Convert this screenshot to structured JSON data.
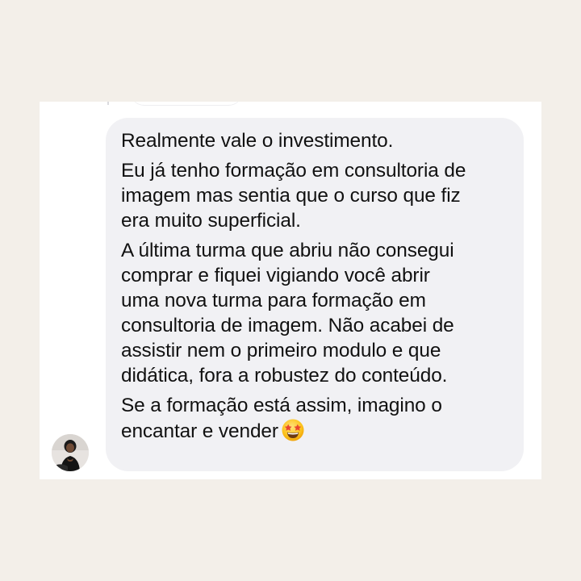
{
  "message": {
    "paragraphs": [
      {
        "lines": [
          "Realmente vale o investimento."
        ]
      },
      {
        "lines": [
          "Eu já tenho formação em consultoria de",
          "imagem mas sentia que o curso que fiz",
          "era muito superficial."
        ]
      },
      {
        "lines": [
          "A última turma que abriu não consegui",
          "comprar e fiquei vigiando você abrir",
          "uma nova turma para formação em",
          "consultoria de imagem. Não acabei de",
          "assistir nem o primeiro modulo e que",
          "didática, fora a robustez do conteúdo."
        ]
      },
      {
        "lines": [
          "Se a formação está assim, imagino o",
          "encantar e vender"
        ]
      }
    ],
    "emoji_icon": "star-struck-emoji-icon"
  },
  "sender": {
    "avatar_icon": "profile-photo-avatar"
  },
  "colors": {
    "page_background": "#f3efe9",
    "card_background": "#ffffff",
    "bubble_background": "#f1f1f4",
    "text": "#111111"
  }
}
